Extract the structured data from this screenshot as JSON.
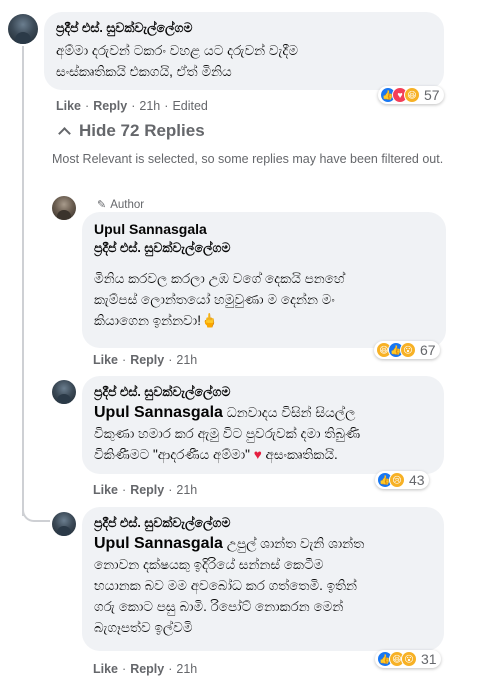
{
  "comment": {
    "author": "ප්‍රදීප් එස්. සුවක්වැල්ලේගම",
    "lines": [
      "අම්මා දරුවන් ටකරං වහළ යට දරුවන් වැදීම",
      "සංස්කෘතිකයි එකගයි, ඒත් මිනිය"
    ],
    "like": "Like",
    "reply": "Reply",
    "time": "21h",
    "edited": "Edited",
    "reaction_count": "57"
  },
  "hide_replies": "Hide 72 Replies",
  "filter_notice": "Most Relevant is selected, so some replies may have been filtered out.",
  "replies": [
    {
      "badge": "Author",
      "author": "Upul Sannasgala",
      "mention": "ප්‍රදීප් එස්. සුවක්වැල්ලේගම",
      "lines": [
        "මිනිය කරවල කරලා උඹ වගේ දෙකයි පනහේ",
        "කැම්පස් ලොන්තයෝ හමුවුණා ම දෙන්න මං",
        "කියාගෙන ඉන්නවා!"
      ],
      "emoji": "🖕",
      "like": "Like",
      "reply": "Reply",
      "time": "21h",
      "reaction_count": "67"
    },
    {
      "author": "ප්‍රදීප් එස්. සුවක්වැල්ලේගම",
      "mention": "Upul Sannasgala",
      "lines_after_mention": "ධනවාදය විසින් සියල්ල",
      "lines": [
        "විකුණා හමාර කර ඇමු විට පුවරුවක් දමා තිබුණි",
        "විකිණීමට \"ආදරණීය අම්මා\""
      ],
      "heart": "♥",
      "tail": "අසංකෘතිකයි.",
      "like": "Like",
      "reply": "Reply",
      "time": "21h",
      "reaction_count": "43"
    },
    {
      "author": "ප්‍රදීප් එස්. සුවක්වැල්ලේගම",
      "mention": "Upul Sannasgala",
      "lines_after_mention": "උපුල් ශාන්ත වැනි ශාන්ත",
      "lines": [
        "නොවන දක්ෂයකු ඉදිරියේ සන්නස් කෙටීම",
        "භයානක බව මම අවබෝධ කර ගත්තෙමි. ඉතින්",
        "ගරු කොට පසු බාමි. රිපෝට් නොකරන මෙන්",
        "බැගෑපත්ව ඉල්වමි"
      ],
      "like": "Like",
      "reply": "Reply",
      "time": "21h",
      "reaction_count": "31"
    }
  ],
  "icons": {
    "like": "like-reaction-icon",
    "love": "love-reaction-icon",
    "haha": "haha-reaction-icon",
    "sad": "sad-reaction-icon",
    "wow": "wow-reaction-icon"
  },
  "colors": {
    "bubble": "#f0f2f5",
    "secondary_text": "#65676b",
    "like_blue": "#1877f2",
    "love_red": "#f33e58",
    "emoji_yellow": "#f7b125"
  }
}
